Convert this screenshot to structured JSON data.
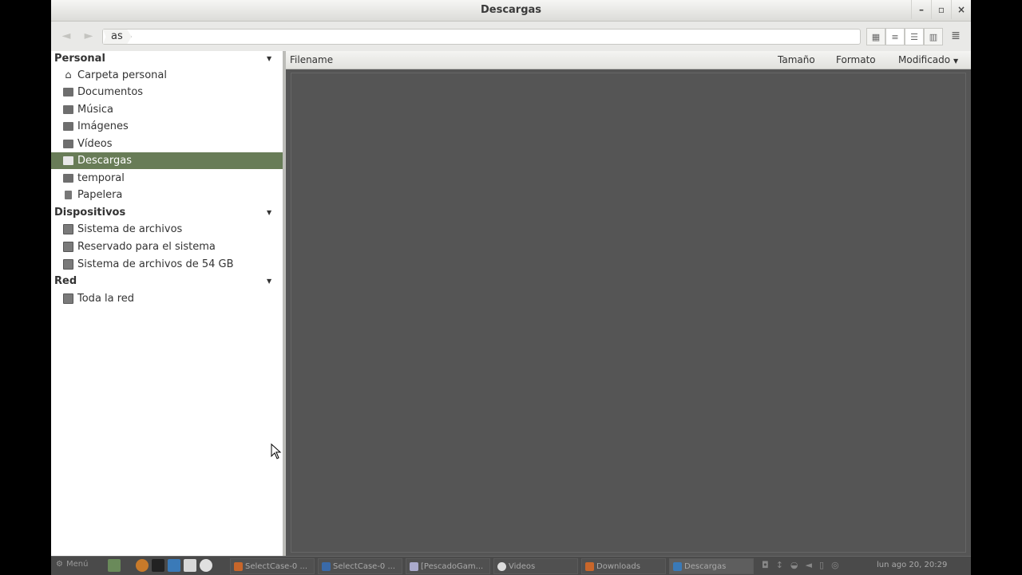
{
  "window": {
    "title": "Descargas",
    "controls": [
      "–",
      "▫",
      "×"
    ]
  },
  "toolbar": {
    "back_glyph": "◄",
    "forward_glyph": "►",
    "breadcrumb": "as",
    "view_icons": [
      "icon-view-icon",
      "compact-view-icon",
      "list-view-icon",
      "column-view-icon"
    ],
    "menu_glyph": "≣"
  },
  "sidebar": {
    "sections": {
      "personal": {
        "title": "Personal",
        "items": [
          {
            "label": "Carpeta personal",
            "icon": "home-icon"
          },
          {
            "label": "Documentos",
            "icon": "folder-icon"
          },
          {
            "label": "Música",
            "icon": "folder-icon"
          },
          {
            "label": "Imágenes",
            "icon": "folder-icon"
          },
          {
            "label": "Vídeos",
            "icon": "folder-icon"
          },
          {
            "label": "Descargas",
            "icon": "folder-icon",
            "selected": true
          },
          {
            "label": "temporal",
            "icon": "folder-icon"
          },
          {
            "label": "Papelera",
            "icon": "trash-icon"
          }
        ]
      },
      "devices": {
        "title": "Dispositivos",
        "items": [
          {
            "label": "Sistema de archivos",
            "icon": "drive-icon"
          },
          {
            "label": "Reservado para el sistema",
            "icon": "drive-icon"
          },
          {
            "label": "Sistema de archivos de 54 GB",
            "icon": "drive-icon"
          }
        ]
      },
      "network": {
        "title": "Red",
        "items": [
          {
            "label": "Toda la red",
            "icon": "network-folder-icon"
          }
        ]
      }
    },
    "selected_color": "#687c57"
  },
  "columns": {
    "filename": "Filename",
    "size": "Tamaño",
    "format": "Formato",
    "modified": "Modificado"
  },
  "taskbar": {
    "menu_label": "Menú",
    "tasks": [
      {
        "label": "SelectCase-0 ..."
      },
      {
        "label": "SelectCase-0 ..."
      },
      {
        "label": "[PescadoGam..."
      },
      {
        "label": "Videos"
      },
      {
        "label": "Downloads"
      },
      {
        "label": "Descargas"
      }
    ],
    "clock": "lun ago 20, 20:29"
  }
}
